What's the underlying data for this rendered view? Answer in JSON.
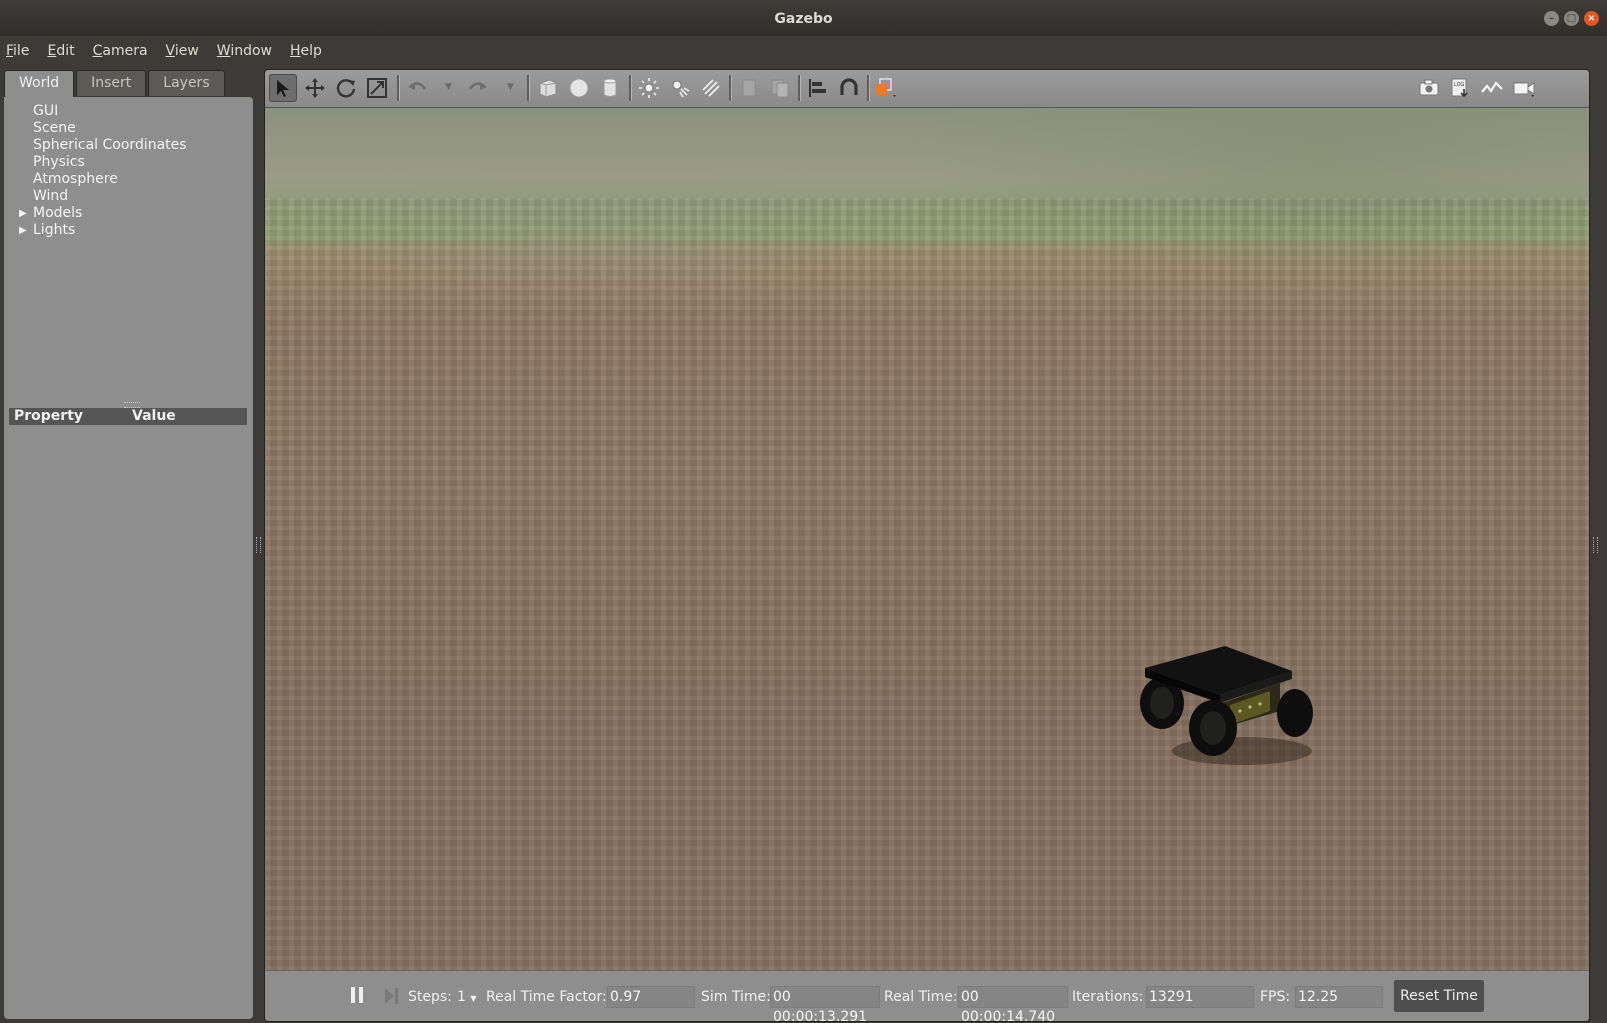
{
  "window": {
    "title": "Gazebo"
  },
  "menu": [
    "File",
    "Edit",
    "Camera",
    "View",
    "Window",
    "Help"
  ],
  "left_tabs": [
    {
      "label": "World",
      "active": true
    },
    {
      "label": "Insert",
      "active": false
    },
    {
      "label": "Layers",
      "active": false
    }
  ],
  "world_tree": [
    {
      "label": "GUI",
      "expandable": false
    },
    {
      "label": "Scene",
      "expandable": false
    },
    {
      "label": "Spherical Coordinates",
      "expandable": false
    },
    {
      "label": "Physics",
      "expandable": false
    },
    {
      "label": "Atmosphere",
      "expandable": false
    },
    {
      "label": "Wind",
      "expandable": false
    },
    {
      "label": "Models",
      "expandable": true
    },
    {
      "label": "Lights",
      "expandable": true
    }
  ],
  "property_table": {
    "col_property": "Property",
    "col_value": "Value"
  },
  "toolbar": {
    "left_tools": [
      "select-mode-icon",
      "translate-mode-icon",
      "rotate-mode-icon",
      "scale-mode-icon",
      "undo-icon",
      "redo-icon",
      "box-shape-icon",
      "sphere-shape-icon",
      "cylinder-shape-icon",
      "point-light-icon",
      "spot-light-icon",
      "directional-light-icon",
      "copy-icon",
      "paste-icon",
      "align-icon",
      "snap-icon",
      "view-angle-icon"
    ],
    "right_tools": [
      "screenshot-icon",
      "log-icon",
      "plot-icon",
      "record-video-icon"
    ],
    "accent": "#f07b1e"
  },
  "status": {
    "steps_label": "Steps:",
    "steps_value": "1",
    "rtf_label": "Real Time Factor:",
    "rtf_value": "0.97",
    "sim_time_label": "Sim Time:",
    "sim_time_value": "00 00:00:13.291",
    "real_time_label": "Real Time:",
    "real_time_value": "00 00:00:14.740",
    "iterations_label": "Iterations:",
    "iterations_value": "13291",
    "fps_label": "FPS:",
    "fps_value": "12.25",
    "reset_label": "Reset Time"
  }
}
